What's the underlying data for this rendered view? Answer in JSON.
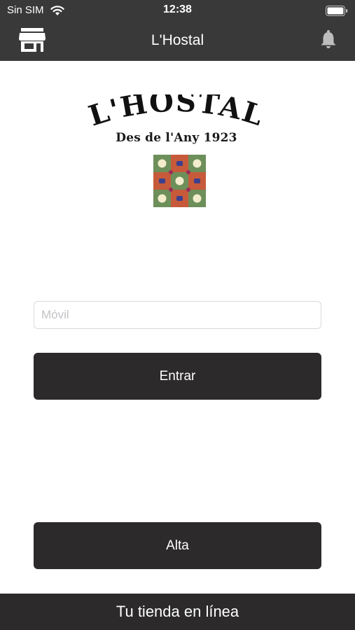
{
  "status_bar": {
    "carrier": "Sin SIM",
    "time": "12:38"
  },
  "nav": {
    "title": "L'Hostal",
    "left_icon": "store-icon",
    "right_icon": "bell-icon"
  },
  "logo": {
    "title": "L'HOSTAL",
    "subtitle": "Des de  l'Any 1923"
  },
  "form": {
    "phone_placeholder": "Móvil",
    "phone_value": "",
    "login_label": "Entrar",
    "signup_label": "Alta"
  },
  "footer": {
    "label": "Tu tienda en línea"
  },
  "colors": {
    "bar": "#3a393a",
    "button": "#2c2a2b",
    "text_light": "#ffffff"
  }
}
